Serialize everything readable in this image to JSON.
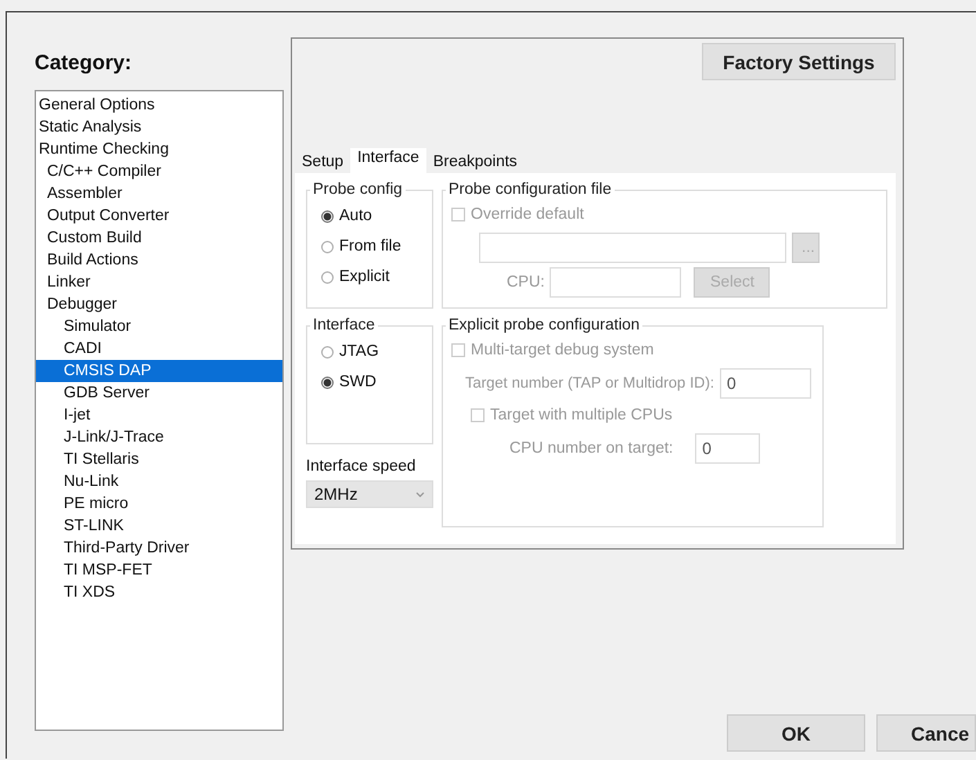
{
  "category_label": "Category:",
  "categories": [
    {
      "label": "General Options",
      "kind": "plain",
      "selected": false
    },
    {
      "label": "Static Analysis",
      "kind": "plain",
      "selected": false
    },
    {
      "label": "Runtime Checking",
      "kind": "plain",
      "selected": false
    },
    {
      "label": "C/C++ Compiler",
      "kind": "tool",
      "selected": false
    },
    {
      "label": "Assembler",
      "kind": "tool",
      "selected": false
    },
    {
      "label": "Output Converter",
      "kind": "tool",
      "selected": false
    },
    {
      "label": "Custom Build",
      "kind": "tool",
      "selected": false
    },
    {
      "label": "Build Actions",
      "kind": "tool",
      "selected": false
    },
    {
      "label": "Linker",
      "kind": "tool",
      "selected": false
    },
    {
      "label": "Debugger",
      "kind": "tool",
      "selected": false,
      "children": [
        {
          "label": "Simulator",
          "selected": false
        },
        {
          "label": "CADI",
          "selected": false
        },
        {
          "label": "CMSIS DAP",
          "selected": true
        },
        {
          "label": "GDB Server",
          "selected": false
        },
        {
          "label": "I-jet",
          "selected": false
        },
        {
          "label": "J-Link/J-Trace",
          "selected": false
        },
        {
          "label": "TI Stellaris",
          "selected": false
        },
        {
          "label": "Nu-Link",
          "selected": false
        },
        {
          "label": "PE micro",
          "selected": false
        },
        {
          "label": "ST-LINK",
          "selected": false
        },
        {
          "label": "Third-Party Driver",
          "selected": false
        },
        {
          "label": "TI MSP-FET",
          "selected": false
        },
        {
          "label": "TI XDS",
          "selected": false
        }
      ]
    }
  ],
  "factory_settings": "Factory Settings",
  "tabs": [
    {
      "label": "Setup",
      "selected": false
    },
    {
      "label": "Interface",
      "selected": true
    },
    {
      "label": "Breakpoints",
      "selected": false
    }
  ],
  "probe_config": {
    "title": "Probe config",
    "options": [
      {
        "label": "Auto",
        "selected": true
      },
      {
        "label": "From file",
        "selected": false
      },
      {
        "label": "Explicit",
        "selected": false
      }
    ]
  },
  "interface": {
    "title": "Interface",
    "options": [
      {
        "label": "JTAG",
        "selected": false
      },
      {
        "label": "SWD",
        "selected": true
      }
    ]
  },
  "interface_speed": {
    "label": "Interface speed",
    "value": "2MHz"
  },
  "probe_file": {
    "title": "Probe configuration file",
    "override": {
      "label": "Override default",
      "checked": false
    },
    "browse": "...",
    "cpu_label": "CPU:",
    "select": "Select"
  },
  "explicit": {
    "title": "Explicit probe configuration",
    "multi": {
      "label": "Multi-target debug system",
      "checked": false
    },
    "target_label": "Target number (TAP or Multidrop ID):",
    "target_value": "0",
    "multi_cpu": {
      "label": "Target with multiple CPUs",
      "checked": false
    },
    "cpu_number_label": "CPU number on target:",
    "cpu_number_value": "0"
  },
  "buttons": [
    "OK",
    "Cance"
  ]
}
